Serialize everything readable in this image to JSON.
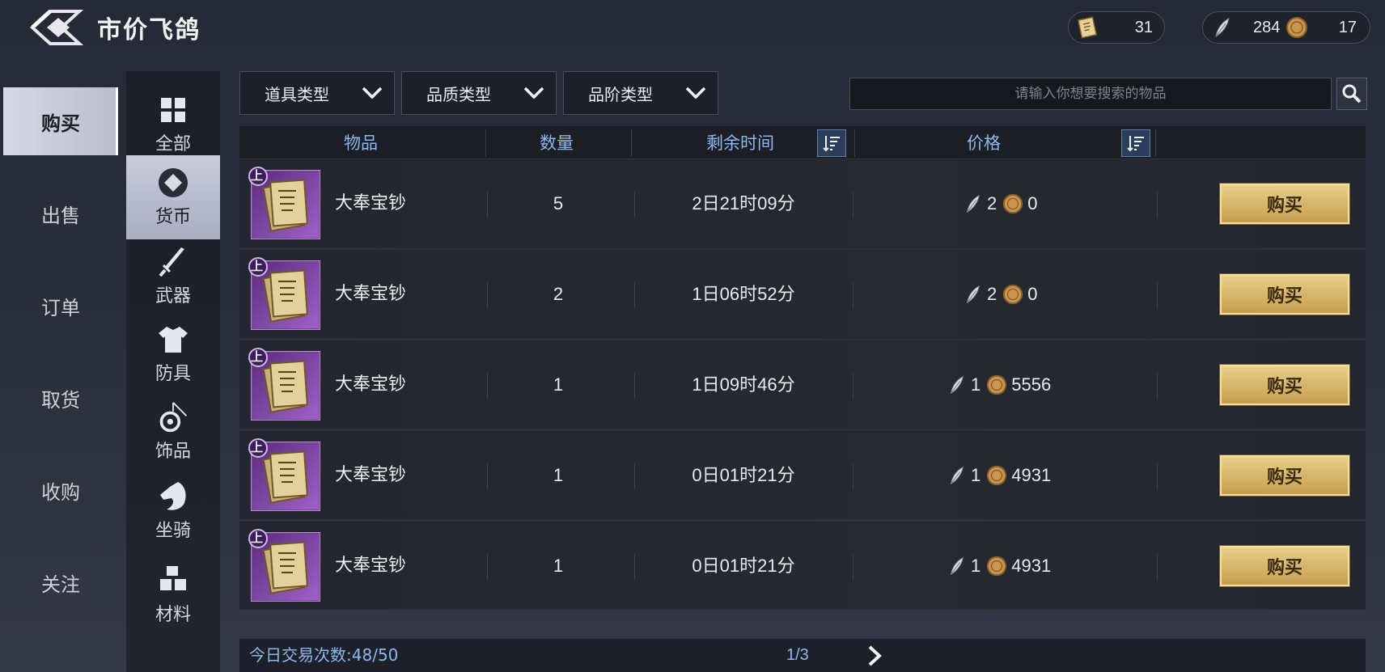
{
  "header": {
    "title": "市价飞鸽",
    "currency_a": "31",
    "currency_b": "284",
    "currency_c": "17"
  },
  "leftnav": [
    "购买",
    "出售",
    "订单",
    "取货",
    "收购",
    "关注"
  ],
  "categories": [
    "全部",
    "货币",
    "武器",
    "防具",
    "饰品",
    "坐骑",
    "材料"
  ],
  "filters": [
    "道具类型",
    "品质类型",
    "品阶类型"
  ],
  "search": {
    "placeholder": "请输入你想要搜索的物品"
  },
  "table_headers": {
    "item": "物品",
    "quantity": "数量",
    "time_left": "剩余时间",
    "price": "价格"
  },
  "rows": [
    {
      "badge": "上",
      "name": "大奉宝钞",
      "qty": "5",
      "time": "2日21时09分",
      "price_a": "2",
      "price_b": "0",
      "buy": "购买"
    },
    {
      "badge": "上",
      "name": "大奉宝钞",
      "qty": "2",
      "time": "1日06时52分",
      "price_a": "2",
      "price_b": "0",
      "buy": "购买"
    },
    {
      "badge": "上",
      "name": "大奉宝钞",
      "qty": "1",
      "time": "1日09时46分",
      "price_a": "1",
      "price_b": "5556",
      "buy": "购买"
    },
    {
      "badge": "上",
      "name": "大奉宝钞",
      "qty": "1",
      "time": "0日01时21分",
      "price_a": "1",
      "price_b": "4931",
      "buy": "购买"
    },
    {
      "badge": "上",
      "name": "大奉宝钞",
      "qty": "1",
      "time": "0日01时21分",
      "price_a": "1",
      "price_b": "4931",
      "buy": "购买"
    }
  ],
  "footer": {
    "trade_label": "今日交易次数:",
    "trade_count": "48/50",
    "page": "1/3"
  },
  "colors": {
    "accent_blue": "#8fb7ee",
    "buy_gold": "#d6b468",
    "item_purple": "#8a4fb0"
  },
  "icons": {
    "back": "back-arrow-icon",
    "currency_a": "scroll-icon",
    "currency_b": "feather-icon",
    "currency_c": "copper-coin-icon",
    "search": "search-icon",
    "sort": "sort-icon",
    "next": "chevron-right-icon"
  }
}
